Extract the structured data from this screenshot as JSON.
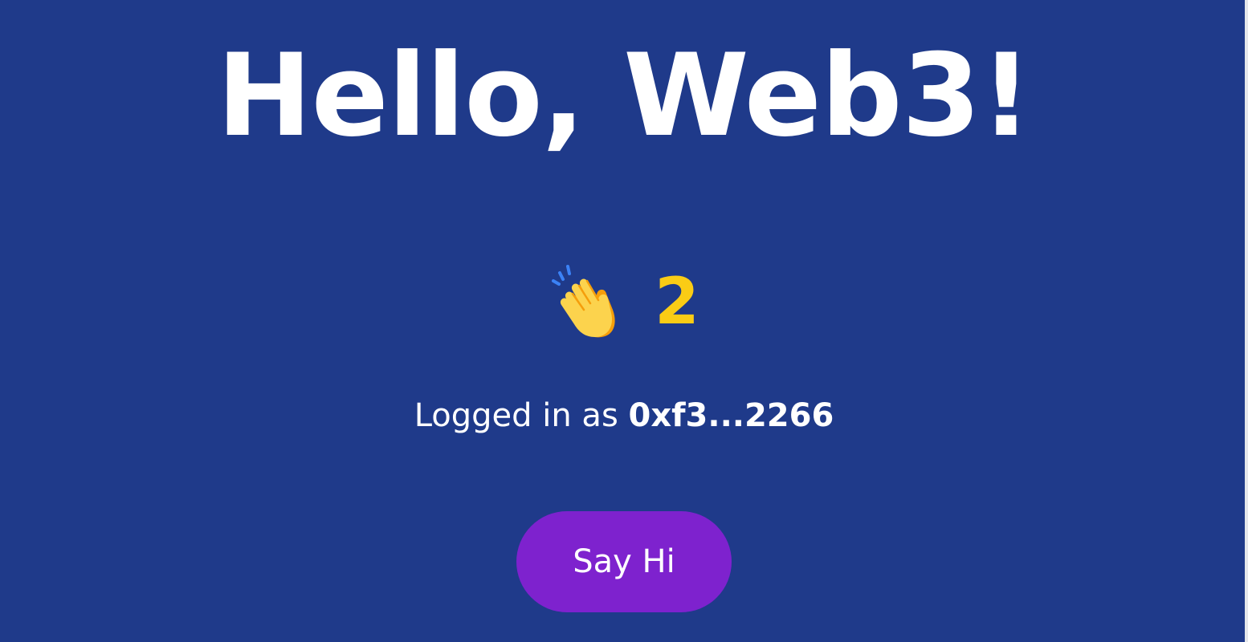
{
  "header": {
    "title": "Hello, Web3!"
  },
  "counter": {
    "icon": "clapping-hands-icon",
    "value": "2"
  },
  "account": {
    "prefix": "Logged in as",
    "address": "0xf3...2266"
  },
  "actions": {
    "say_hi_label": "Say Hi"
  },
  "colors": {
    "background": "#1f3a8a",
    "count": "#facc15",
    "button": "#7e22ce",
    "text": "#ffffff"
  }
}
